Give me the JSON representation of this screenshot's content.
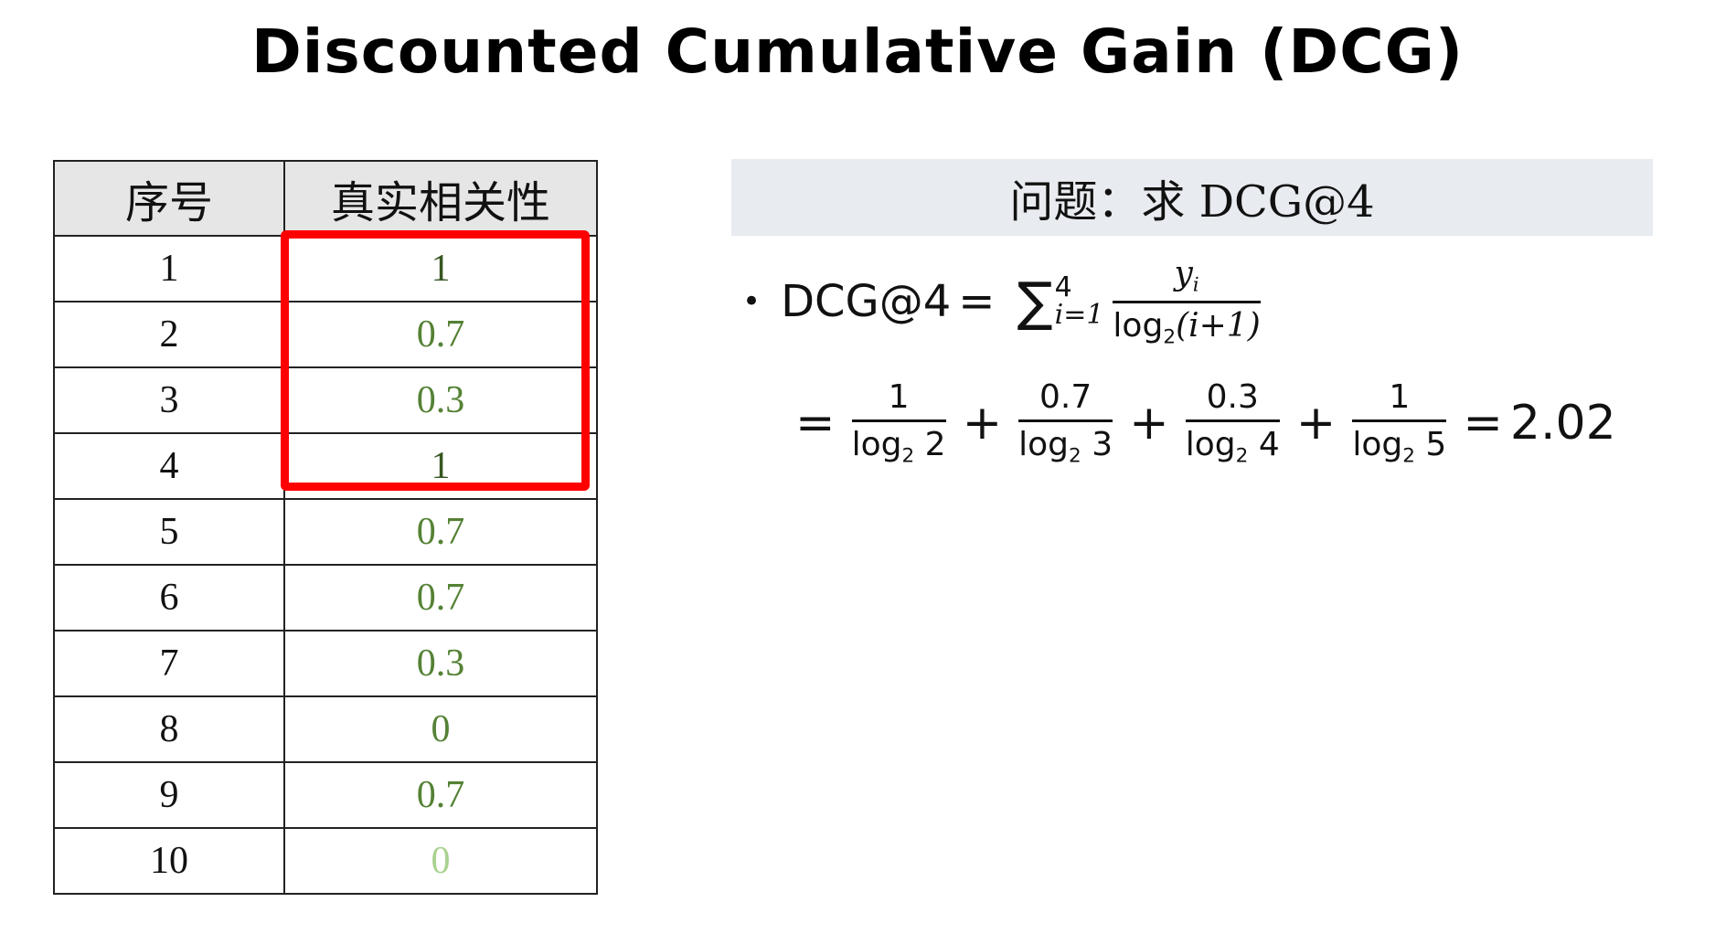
{
  "title": "Discounted  Cumulative  Gain  (DCG)",
  "table": {
    "headers": [
      "序号",
      "真实相关性"
    ],
    "rows": [
      {
        "index": "1",
        "relevance": "1"
      },
      {
        "index": "2",
        "relevance": "0.7"
      },
      {
        "index": "3",
        "relevance": "0.3"
      },
      {
        "index": "4",
        "relevance": "1"
      },
      {
        "index": "5",
        "relevance": "0.7"
      },
      {
        "index": "6",
        "relevance": "0.7"
      },
      {
        "index": "7",
        "relevance": "0.3"
      },
      {
        "index": "8",
        "relevance": "0"
      },
      {
        "index": "9",
        "relevance": "0.7"
      },
      {
        "index": "10",
        "relevance": "0"
      }
    ]
  },
  "question": "问题：求 DCG@4",
  "formula": {
    "bullet": "•",
    "lhs": "DCG@4",
    "equals": "=",
    "sum_symbol": "∑",
    "sum_upper": "4",
    "sum_lower": "i=1",
    "numerator": "y",
    "numerator_sub": "i",
    "denominator_prefix": "log",
    "denominator_base": "2",
    "denominator_arg": "(i+1)",
    "expansion": [
      {
        "num": "1",
        "den_arg": "2"
      },
      {
        "num": "0.7",
        "den_arg": "3"
      },
      {
        "num": "0.3",
        "den_arg": "4"
      },
      {
        "num": "1",
        "den_arg": "5"
      }
    ],
    "plus": "+",
    "result": "2.02"
  },
  "colors": {
    "relevance_green": "#548235",
    "relevance_dark_green": "#385723",
    "relevance_light_green": "#a9d18e",
    "highlight_red": "#ff0000",
    "header_gray": "#e6e6e6",
    "banner_gray": "#e8ebef"
  }
}
